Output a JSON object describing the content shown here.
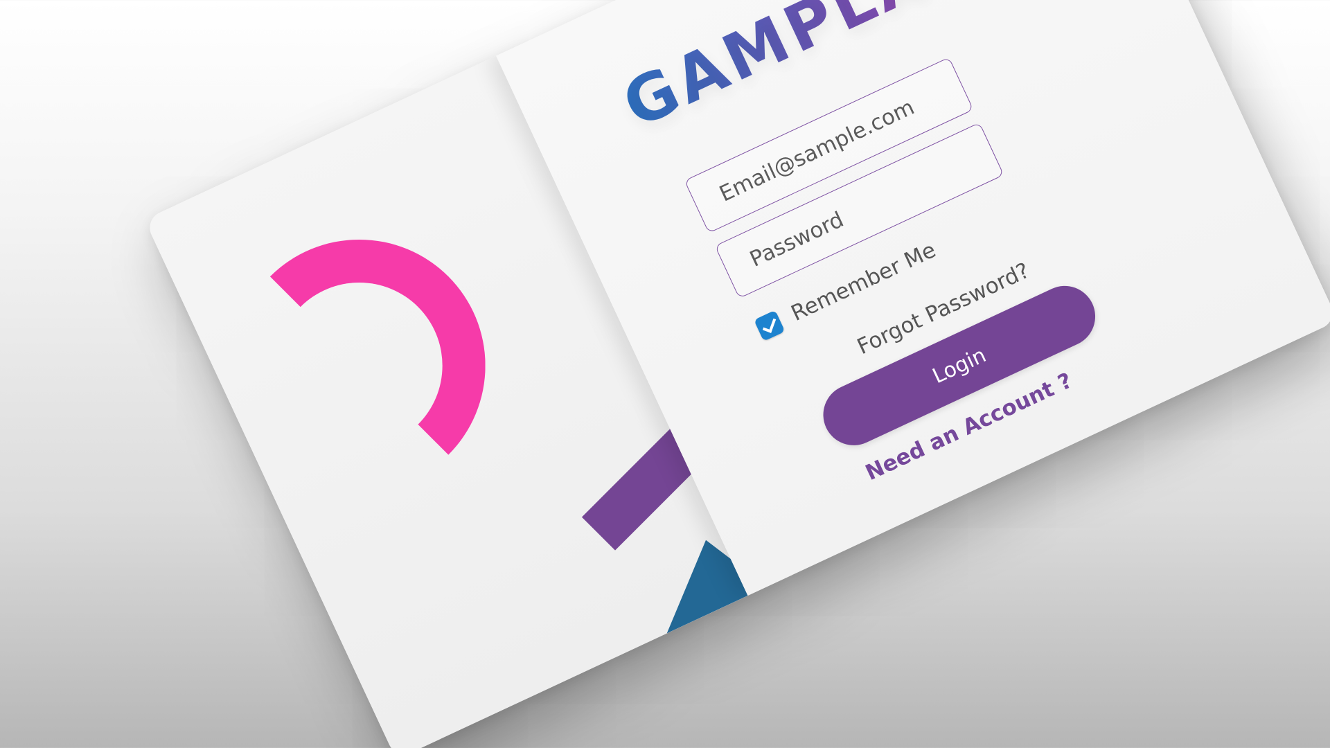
{
  "brand": {
    "name": "GAMPLAYING"
  },
  "form": {
    "email_placeholder": "Email@sample.com",
    "password_placeholder": "Password",
    "remember_label": "Remember Me",
    "forgot_label": "Forgot Password?",
    "login_label": "Login",
    "account_label": "Need an Account ?"
  },
  "decor": {
    "icons": [
      "ring-shape",
      "chevron-shape",
      "triangle-shape"
    ],
    "colors": {
      "pink": "#f63ba9",
      "purple": "#744595",
      "blue": "#236895",
      "checkbox_blue": "#1d83cf"
    }
  }
}
